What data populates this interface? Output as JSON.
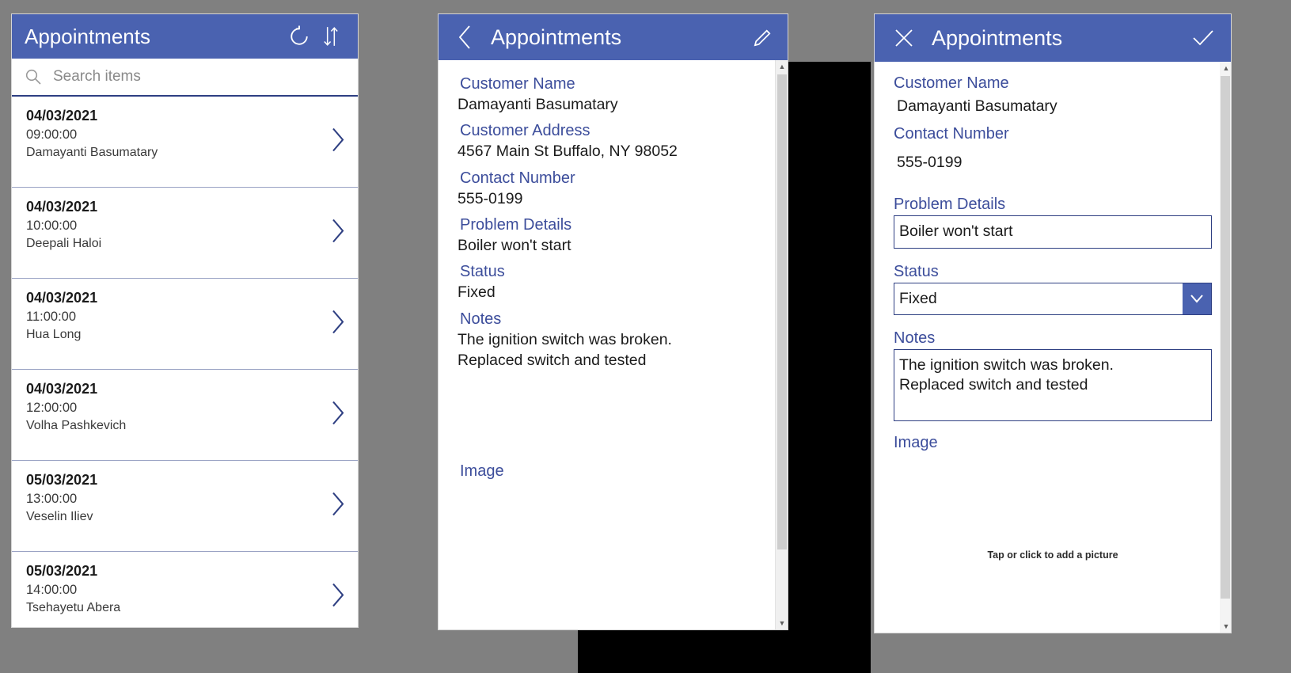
{
  "theme": {
    "accent": "#4a62b0",
    "accent_dark": "#2e3f82",
    "label_blue": "#3c4d9b",
    "page_background": "#808080"
  },
  "browse_screen": {
    "title": "Appointments",
    "icons": {
      "refresh": "refresh-icon",
      "sort": "sort-icon",
      "search": "search-icon",
      "chevron": "chevron-right-icon"
    },
    "search": {
      "placeholder": "Search items",
      "value": ""
    },
    "items": [
      {
        "date": "04/03/2021",
        "time": "09:00:00",
        "name": "Damayanti Basumatary"
      },
      {
        "date": "04/03/2021",
        "time": "10:00:00",
        "name": "Deepali Haloi"
      },
      {
        "date": "04/03/2021",
        "time": "11:00:00",
        "name": "Hua Long"
      },
      {
        "date": "04/03/2021",
        "time": "12:00:00",
        "name": "Volha Pashkevich"
      },
      {
        "date": "05/03/2021",
        "time": "13:00:00",
        "name": "Veselin Iliev"
      },
      {
        "date": "05/03/2021",
        "time": "14:00:00",
        "name": "Tsehayetu Abera"
      }
    ]
  },
  "detail_screen": {
    "title": "Appointments",
    "icons": {
      "back": "chevron-left-icon",
      "edit": "pencil-icon"
    },
    "fields": [
      {
        "label": "Customer Name",
        "value": "Damayanti Basumatary"
      },
      {
        "label": "Customer Address",
        "value": "4567 Main St Buffalo, NY 98052"
      },
      {
        "label": "Contact Number",
        "value": "555-0199"
      },
      {
        "label": "Problem Details",
        "value": "Boiler won't start"
      },
      {
        "label": "Status",
        "value": "Fixed"
      },
      {
        "label": "Notes",
        "value": "The ignition switch was broken.\nReplaced switch and tested"
      }
    ],
    "image_label": "Image"
  },
  "edit_screen": {
    "title": "Appointments",
    "icons": {
      "cancel": "close-icon",
      "save": "check-icon",
      "dropdown": "chevron-down-icon"
    },
    "fields": {
      "customer_name": {
        "label": "Customer Name",
        "value": "Damayanti Basumatary"
      },
      "contact_number": {
        "label": "Contact Number",
        "value": "555-0199"
      },
      "problem_details": {
        "label": "Problem Details",
        "value": "Boiler won't start"
      },
      "status": {
        "label": "Status",
        "value": "Fixed"
      },
      "notes": {
        "label": "Notes",
        "value": "The ignition switch was broken.\nReplaced switch and tested"
      },
      "image": {
        "label": "Image",
        "hint": "Tap or click to add a picture"
      }
    }
  }
}
